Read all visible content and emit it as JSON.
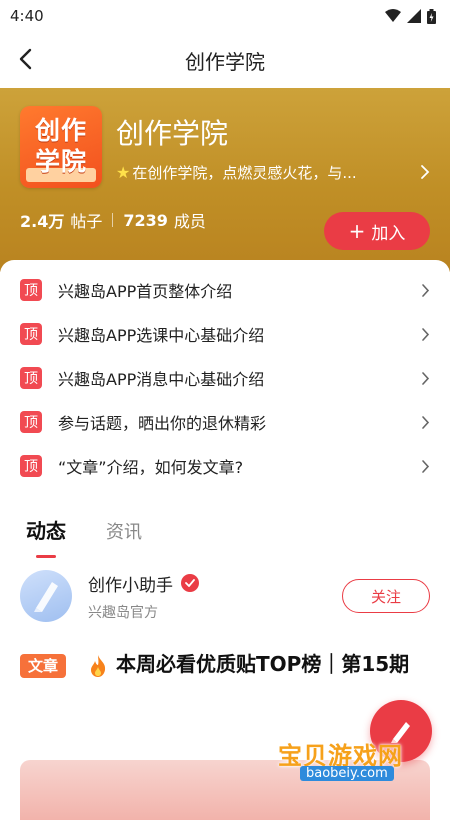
{
  "status_bar": {
    "time": "4:40"
  },
  "nav": {
    "title": "创作学院"
  },
  "hero": {
    "logo_text": "创作学院",
    "title": "创作学院",
    "description": "在创作学院，点燃灵感火花，与...",
    "posts_count": "2.4万",
    "posts_label": "帖子",
    "members_count": "7239",
    "members_label": "成员",
    "join_label": "加入",
    "join_icon": "+"
  },
  "pinned": {
    "badge": "顶",
    "items": [
      {
        "title": "兴趣岛APP首页整体介绍"
      },
      {
        "title": "兴趣岛APP选课中心基础介绍"
      },
      {
        "title": "兴趣岛APP消息中心基础介绍"
      },
      {
        "title": "参与话题，晒出你的退休精彩"
      },
      {
        "title": "“文章”介绍，如何发文章?"
      }
    ]
  },
  "tabs": [
    {
      "label": "动态",
      "active": true
    },
    {
      "label": "资讯",
      "active": false
    }
  ],
  "post": {
    "author_name": "创作小助手",
    "author_sub": "兴趣岛官方",
    "follow_label": "关注",
    "tag": "文章",
    "title": "本周必看优质贴TOP榜｜第15期"
  },
  "watermark": {
    "text": "宝贝游戏网",
    "sub": "baobeiy.com"
  },
  "colors": {
    "accent": "#ea3c45",
    "hero_gold": "#c49226",
    "tag_orange": "#f6713a"
  },
  "icons": {
    "back": "chevron-left-icon",
    "chevron": "chevron-right-icon",
    "verified": "verified-icon",
    "flame": "flame-icon",
    "star": "star-icon",
    "fab": "pen-icon"
  }
}
